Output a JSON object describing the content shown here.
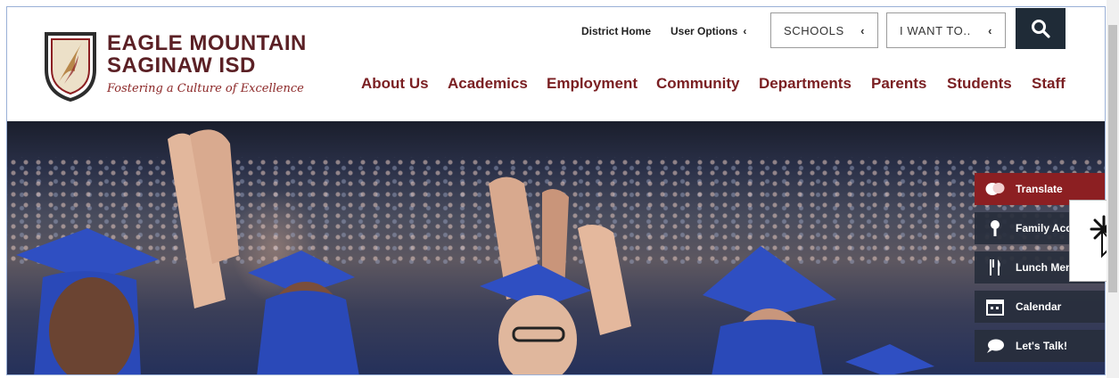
{
  "logo": {
    "line1": "EAGLE MOUNTAIN",
    "line2": "SAGINAW ISD",
    "tagline": "Fostering a Culture of Excellence"
  },
  "utility": {
    "district_home": "District Home",
    "user_options": "User Options",
    "schools": "SCHOOLS",
    "i_want_to": "I WANT TO..",
    "chevron": "‹"
  },
  "nav": [
    "About Us",
    "Academics",
    "Employment",
    "Community",
    "Departments",
    "Parents",
    "Students",
    "Staff"
  ],
  "side_menu": [
    {
      "label": "Translate",
      "icon": "translate-icon"
    },
    {
      "label": "Family Acc",
      "icon": "pin-icon"
    },
    {
      "label": "Lunch Men",
      "icon": "utensils-icon"
    },
    {
      "label": "Calendar",
      "icon": "calendar-icon"
    },
    {
      "label": "Let's Talk!",
      "icon": "chat-icon"
    }
  ],
  "colors": {
    "brand": "#7a1f22",
    "search": "#1f2b37",
    "translate_bg": "#8c1f22",
    "side_bg": "#282e3c"
  }
}
